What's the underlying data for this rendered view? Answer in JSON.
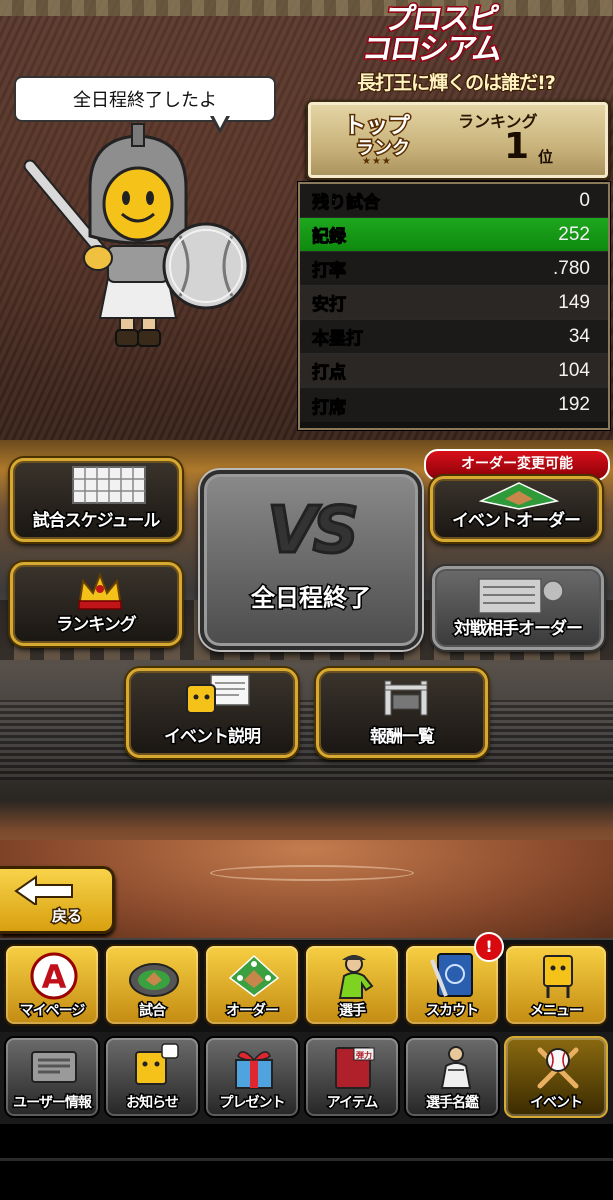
{
  "header": {
    "logo_line1": "プロスピ",
    "logo_line2": "コロシアム",
    "tagline": "長打王に輝くのは誰だ!?"
  },
  "speech_bubble": "全日程終了したよ",
  "rank": {
    "tier_top": "トップ",
    "tier_rank": "ランク",
    "stars": "★★★",
    "ranking_label": "ランキング",
    "position": "1",
    "position_suffix": "位"
  },
  "stats": [
    {
      "label": "残り試合",
      "value": "0"
    },
    {
      "label": "記録",
      "value": "252",
      "highlight": true
    },
    {
      "label": "打率",
      "value": ".780"
    },
    {
      "label": "安打",
      "value": "149"
    },
    {
      "label": "本塁打",
      "value": "34"
    },
    {
      "label": "打点",
      "value": "104"
    },
    {
      "label": "打席",
      "value": "192"
    }
  ],
  "menu": {
    "schedule": "試合スケジュール",
    "ranking": "ランキング",
    "vs": "VS",
    "vs_status": "全日程終了",
    "order_flag": "オーダー変更可能",
    "event_order": "イベントオーダー",
    "opponent_order": "対戦相手オーダー",
    "event_help": "イベント説明",
    "rewards": "報酬一覧",
    "back": "戻る"
  },
  "nav_primary": [
    {
      "label": "マイページ",
      "icon": "a-logo-icon"
    },
    {
      "label": "試合",
      "icon": "stadium-icon"
    },
    {
      "label": "オーダー",
      "icon": "field-lineup-icon"
    },
    {
      "label": "選手",
      "icon": "player-icon"
    },
    {
      "label": "スカウト",
      "icon": "scout-book-icon",
      "badge": "!"
    },
    {
      "label": "メニュー",
      "icon": "mascot-menu-icon"
    }
  ],
  "nav_secondary": [
    {
      "label": "ユーザー情報",
      "icon": "user-card-icon"
    },
    {
      "label": "お知らせ",
      "icon": "notice-icon"
    },
    {
      "label": "プレゼント",
      "icon": "gift-icon"
    },
    {
      "label": "アイテム",
      "icon": "item-book-icon",
      "item_tag": "弾力"
    },
    {
      "label": "選手名鑑",
      "icon": "player-catalog-icon"
    },
    {
      "label": "イベント",
      "icon": "event-ball-icon"
    }
  ],
  "colors": {
    "gold": "#d8a930",
    "highlight_green": "#1ea71e",
    "alert_red": "#d80a10"
  }
}
